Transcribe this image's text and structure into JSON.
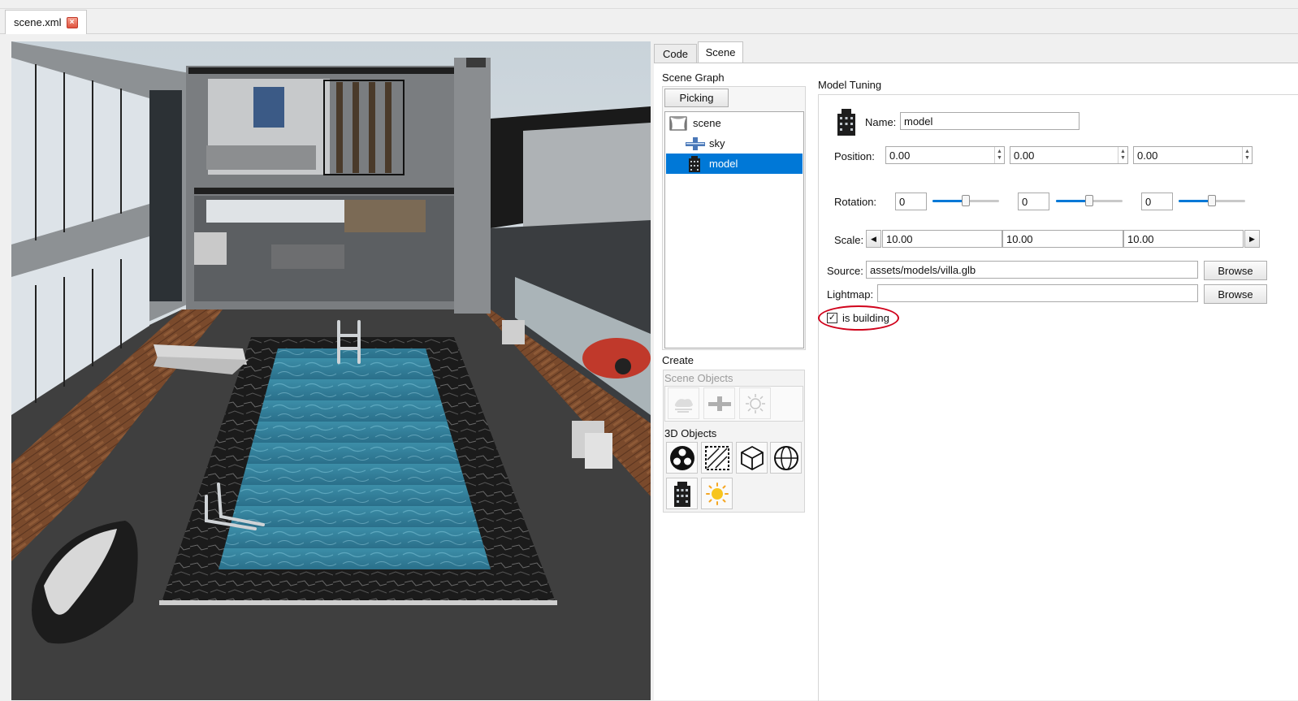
{
  "editor": {
    "file_tab": "scene.xml"
  },
  "panel": {
    "tabs": [
      {
        "label": "Code",
        "active": false
      },
      {
        "label": "Scene",
        "active": true
      }
    ],
    "scene_graph": {
      "title": "Scene Graph",
      "picking_button": "Picking",
      "items": [
        {
          "label": "scene",
          "icon": "stage-curtain-icon",
          "selected": false
        },
        {
          "label": "sky",
          "icon": "sky-icon",
          "selected": false
        },
        {
          "label": "model",
          "icon": "building-icon",
          "selected": true
        }
      ]
    },
    "create": {
      "title": "Create",
      "scene_objects_label": "Scene Objects",
      "scene_objects": [
        "fog-icon",
        "sky-icon",
        "light-icon"
      ],
      "objects_3d_label": "3D Objects",
      "objects_3d": [
        "particles-icon",
        "plane-icon",
        "box-icon",
        "sphere-icon",
        "building-icon",
        "sun-icon"
      ]
    },
    "model_tuning": {
      "title": "Model Tuning",
      "name_label": "Name:",
      "name_value": "model",
      "position_label": "Position:",
      "position": [
        "0.00",
        "0.00",
        "0.00"
      ],
      "rotation_label": "Rotation:",
      "rotation": [
        "0",
        "0",
        "0"
      ],
      "rotation_slider_level": 0.5,
      "scale_label": "Scale:",
      "scale": [
        "10.00",
        "10.00",
        "10.00"
      ],
      "source_label": "Source:",
      "source_value": "assets/models/villa.glb",
      "lightmap_label": "Lightmap:",
      "lightmap_value": "",
      "browse_label": "Browse",
      "is_building_label": "is building",
      "is_building_checked": true
    }
  },
  "colors": {
    "selection": "#0078d7",
    "annotation_circle": "#d0021b"
  }
}
